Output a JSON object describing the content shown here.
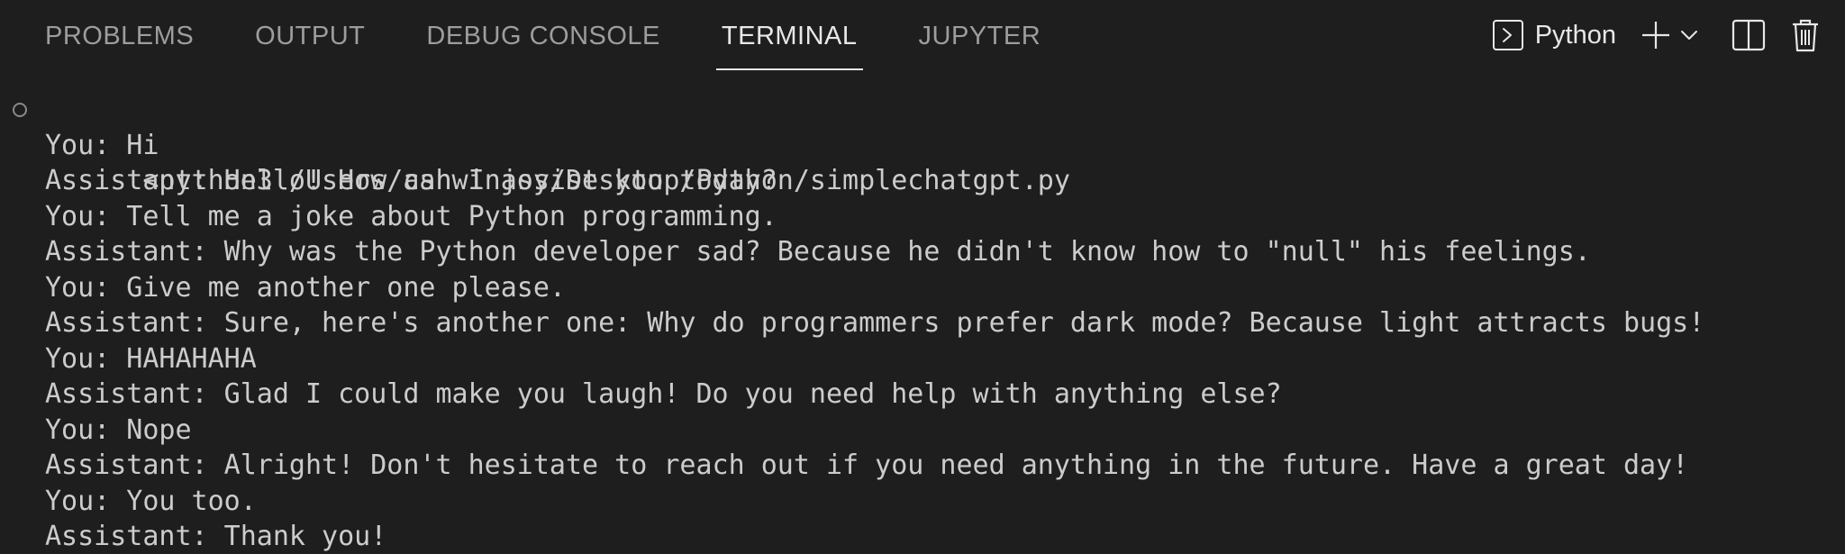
{
  "panel_tabs": [
    {
      "label": "PROBLEMS",
      "active": false
    },
    {
      "label": "OUTPUT",
      "active": false
    },
    {
      "label": "DEBUG CONSOLE",
      "active": false
    },
    {
      "label": "TERMINAL",
      "active": true
    },
    {
      "label": "JUPYTER",
      "active": false
    }
  ],
  "terminal_profile": {
    "label": "Python",
    "icon": "terminal-prompt-icon"
  },
  "actions": {
    "new_terminal_icon": "plus-icon",
    "dropdown_icon": "chevron-down-icon",
    "split_icon": "split-editor-icon",
    "kill_icon": "trash-icon"
  },
  "terminal": {
    "command_line": "<python3 /Users/ashwinjoy/Desktop/Python/simplechatgpt.py",
    "lines": [
      "You: Hi",
      "Assistant: Hello! How can I assist you today?",
      "You: Tell me a joke about Python programming.",
      "Assistant: Why was the Python developer sad? Because he didn't know how to \"null\" his feelings.",
      "You: Give me another one please.",
      "Assistant: Sure, here's another one: Why do programmers prefer dark mode? Because light attracts bugs!",
      "You: HAHAHAHA",
      "Assistant: Glad I could make you laugh! Do you need help with anything else?",
      "You: Nope",
      "Assistant: Alright! Don't hesitate to reach out if you need anything in the future. Have a great day!",
      "You: You too.",
      "Assistant: Thank you!"
    ]
  },
  "colors": {
    "background": "#1e1e1e",
    "text": "#cccccc",
    "tab_inactive": "#9d9d9d",
    "tab_active": "#e7e7e7"
  }
}
